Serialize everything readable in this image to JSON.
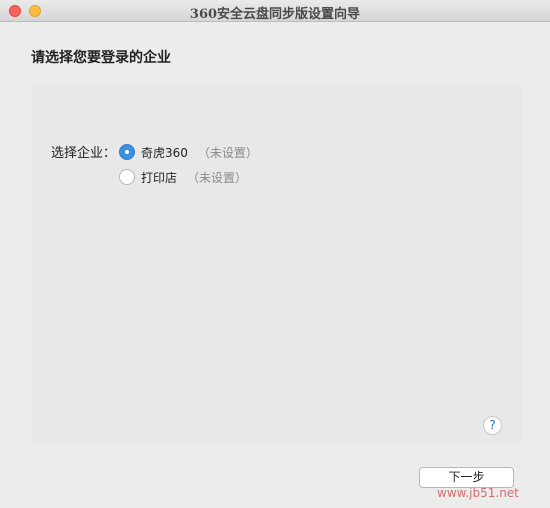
{
  "window": {
    "title": "360安全云盘同步版设置向导"
  },
  "main": {
    "heading": "请选择您要登录的企业",
    "form_label": "选择企业：",
    "options": [
      {
        "name": "奇虎360",
        "status": "（未设置）",
        "selected": true
      },
      {
        "name": "打印店",
        "status": "（未设置）",
        "selected": false
      }
    ]
  },
  "footer": {
    "help_label": "?",
    "next_label": "下一步"
  },
  "watermark": "www.jb51.net"
}
